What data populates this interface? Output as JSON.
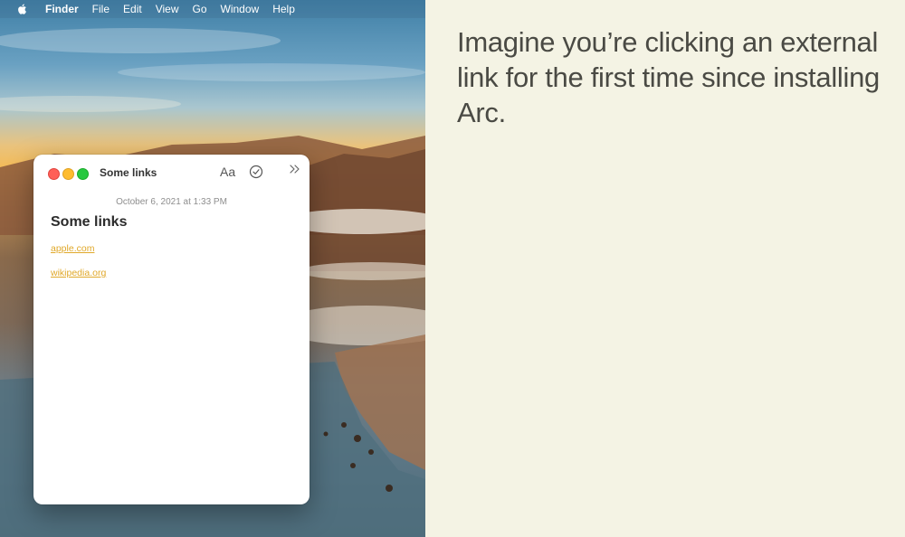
{
  "menubar": {
    "apple_icon": "apple-icon",
    "items": [
      "Finder",
      "File",
      "Edit",
      "View",
      "Go",
      "Window",
      "Help"
    ]
  },
  "notes_window": {
    "title": "Some links",
    "toolbar": {
      "format_label": "Aa",
      "format_icon": "text-format-icon",
      "checklist_icon": "checklist-icon",
      "more_icon": "chevron-double-right-icon"
    },
    "note": {
      "date": "October 6, 2021 at 1:33 PM",
      "heading": "Some links",
      "links": [
        "apple.com",
        "wikipedia.org"
      ]
    }
  },
  "right_panel": {
    "headline": "Imagine you’re clicking an external link for the first time since installing Arc."
  },
  "colors": {
    "link": "#e0a82a",
    "panel_bg": "#f4f3e4",
    "headline": "#4a4a44",
    "close": "#ff5f57",
    "minimize": "#febc2e",
    "zoom": "#28c840"
  }
}
